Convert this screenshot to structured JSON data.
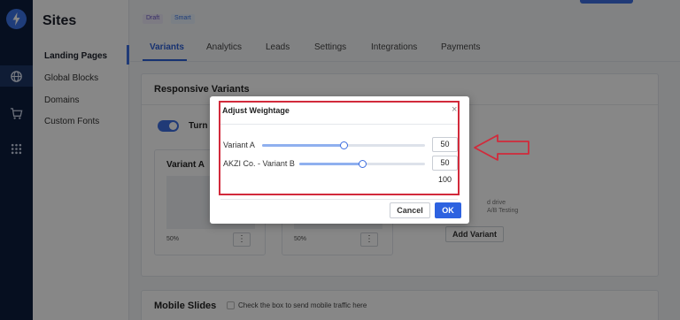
{
  "sidebar": {
    "title": "Sites",
    "items": [
      {
        "label": "Landing Pages"
      },
      {
        "label": "Global Blocks"
      },
      {
        "label": "Domains"
      },
      {
        "label": "Custom Fonts"
      }
    ]
  },
  "header": {
    "tags": [
      "Draft",
      "Smart"
    ]
  },
  "tabs": [
    "Variants",
    "Analytics",
    "Leads",
    "Settings",
    "Integrations",
    "Payments"
  ],
  "responsive": {
    "title": "Responsive Variants",
    "toggle_label": "Turn o",
    "variant_a": {
      "title": "Variant A",
      "percent": "50%"
    },
    "variant_b": {
      "percent": "50%"
    },
    "add_drive_text": "d drive",
    "ab_text": "A/B Testing",
    "add_variant": "Add Variant"
  },
  "mobile": {
    "title": "Mobile Slides",
    "checkbox_label": "Check the box to send mobile traffic here"
  },
  "modal": {
    "title": "Adjust Weightage",
    "close": "×",
    "rows": [
      {
        "label": "Variant A",
        "value": "50",
        "fraction": 0.5
      },
      {
        "label": "AKZI Co. - Variant B",
        "value": "50",
        "fraction": 0.5
      }
    ],
    "total": "100",
    "cancel": "Cancel",
    "ok": "OK"
  },
  "colors": {
    "accent": "#2d62e0",
    "highlight": "#d22a3b",
    "rail": "#0c1d3d"
  }
}
